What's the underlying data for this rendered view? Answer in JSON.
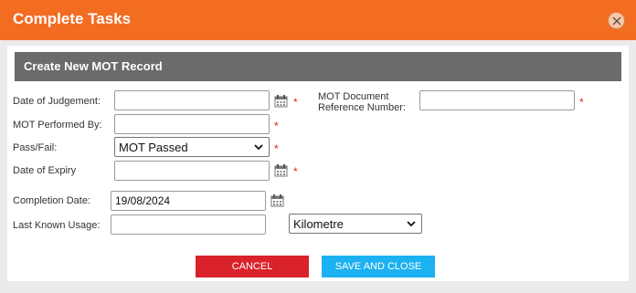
{
  "dialog": {
    "title": "Complete Tasks",
    "close_icon": "close-icon"
  },
  "section": {
    "title": "Create New MOT Record"
  },
  "fields": {
    "date_of_judgement": {
      "label": "Date of Judgement:",
      "value": "",
      "required": "*"
    },
    "mot_performed_by": {
      "label": "MOT Performed By:",
      "value": "",
      "required": "*"
    },
    "pass_fail": {
      "label": "Pass/Fail:",
      "value": "MOT Passed",
      "required": "*"
    },
    "date_of_expiry": {
      "label": "Date of Expiry",
      "value": "",
      "required": "*"
    },
    "mot_doc_ref": {
      "label_line1": "MOT Document",
      "label_line2": "Reference Number:",
      "value": "",
      "required": "*"
    },
    "completion_date": {
      "label": "Completion Date:",
      "value": "19/08/2024"
    },
    "last_known_usage": {
      "label": "Last Known Usage:",
      "value": "",
      "unit": "Kilometre"
    }
  },
  "buttons": {
    "cancel": "CANCEL",
    "save": "SAVE AND CLOSE"
  },
  "colors": {
    "header": "#f26c22",
    "section": "#6b6b6b",
    "cancel": "#d9222a",
    "save": "#1cb1f0",
    "required": "#d9251d"
  }
}
